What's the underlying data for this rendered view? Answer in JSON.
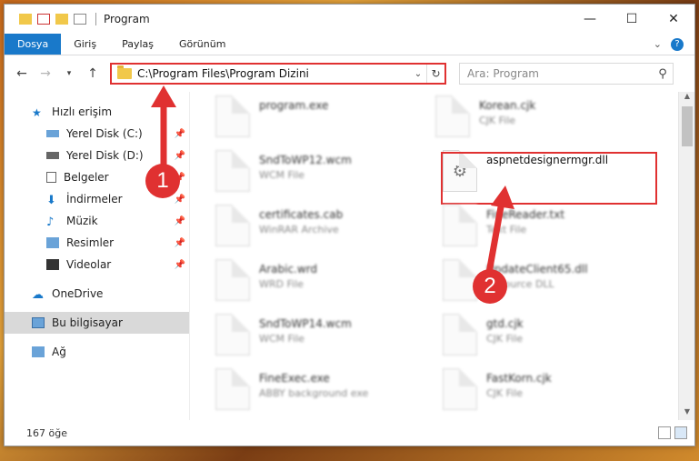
{
  "window": {
    "title": "Program"
  },
  "ribbon": {
    "tabs": [
      "Dosya",
      "Giriş",
      "Paylaş",
      "Görünüm"
    ]
  },
  "address": {
    "path": "C:\\Program Files\\Program Dizini"
  },
  "search": {
    "placeholder": "Ara: Program"
  },
  "sidebar": {
    "quick_access": "Hızlı erişim",
    "items": [
      "Yerel Disk (C:)",
      "Yerel Disk (D:)",
      "Belgeler",
      "İndirmeler",
      "Müzik",
      "Resimler",
      "Videolar"
    ],
    "onedrive": "OneDrive",
    "this_pc": "Bu bilgisayar",
    "network": "Ağ"
  },
  "files": [
    {
      "name": "program.exe",
      "type": ""
    },
    {
      "name": "Korean.cjk",
      "type": "CJK File"
    },
    {
      "name": "SndToWP12.wcm",
      "type": "WCM File"
    },
    {
      "name": "aspnetdesignermgr.dll",
      "type": ""
    },
    {
      "name": "certificates.cab",
      "type": "WinRAR Archive"
    },
    {
      "name": "FineReader.txt",
      "type": "Text File"
    },
    {
      "name": "Arabic.wrd",
      "type": "WRD File"
    },
    {
      "name": "UpdateClient65.dll",
      "type": "Resource DLL"
    },
    {
      "name": "SndToWP14.wcm",
      "type": "WCM File"
    },
    {
      "name": "gtd.cjk",
      "type": "CJK File"
    },
    {
      "name": "FineExec.exe",
      "type": "ABBY background exe"
    },
    {
      "name": "FastKorn.cjk",
      "type": "CJK File"
    }
  ],
  "status": {
    "count": "167 öğe"
  },
  "annotations": {
    "badge1": "1",
    "badge2": "2"
  },
  "colors": {
    "accent": "#1979ca",
    "highlight": "#e03131"
  }
}
